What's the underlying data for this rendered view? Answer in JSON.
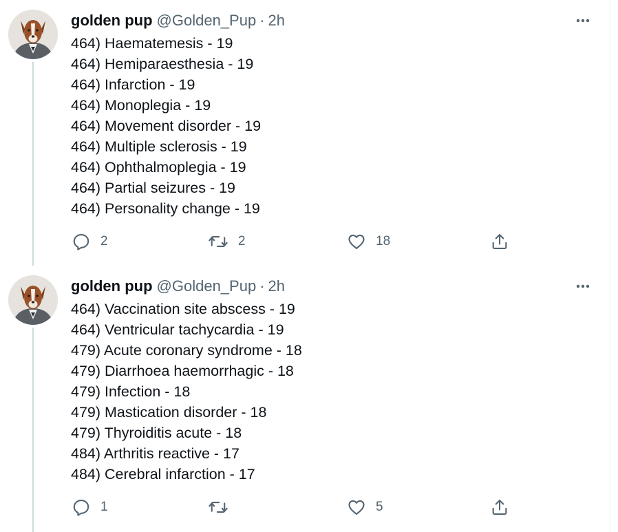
{
  "tweets": [
    {
      "author": {
        "display_name": "golden pup",
        "handle": "@Golden_Pup"
      },
      "dot": "·",
      "time": "2h",
      "lines": [
        "464) Haematemesis - 19",
        "464) Hemiparaesthesia - 19",
        "464) Infarction - 19",
        "464) Monoplegia - 19",
        "464) Movement disorder - 19",
        "464) Multiple sclerosis - 19",
        "464) Ophthalmoplegia - 19",
        "464) Partial seizures - 19",
        "464) Personality change - 19"
      ],
      "actions": {
        "replies": "2",
        "retweets": "2",
        "likes": "18"
      }
    },
    {
      "author": {
        "display_name": "golden pup",
        "handle": "@Golden_Pup"
      },
      "dot": "·",
      "time": "2h",
      "lines": [
        "464) Vaccination site abscess - 19",
        "464) Ventricular tachycardia - 19",
        "479) Acute coronary syndrome - 18",
        "479) Diarrhoea haemorrhagic - 18",
        "479) Infection - 18",
        "479) Mastication disorder - 18",
        "479) Thyroiditis acute - 18",
        "484) Arthritis reactive - 17",
        "484) Cerebral infarction - 17"
      ],
      "actions": {
        "replies": "1",
        "retweets": "",
        "likes": "5"
      }
    }
  ],
  "icons": {
    "more": "more-horizontal-icon",
    "reply": "reply-icon",
    "retweet": "retweet-icon",
    "like": "heart-icon",
    "share": "share-icon"
  },
  "colors": {
    "text_primary": "#0f1419",
    "text_secondary": "#536471",
    "thread_line": "#cfd9de"
  }
}
